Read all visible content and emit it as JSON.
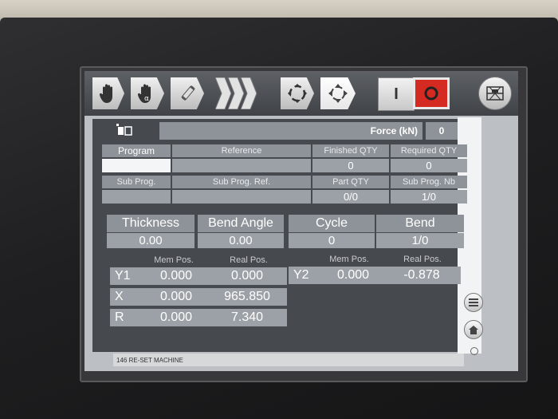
{
  "header": {
    "force_label": "Force (kN)",
    "force_value": "0"
  },
  "program": {
    "headers": [
      "Program",
      "Reference",
      "Finished QTY",
      "Required QTY"
    ],
    "values": [
      "",
      "",
      "0",
      "0"
    ],
    "sub_headers": [
      "Sub Prog.",
      "Sub Prog. Ref.",
      "Part QTY",
      "Sub Prog. Nb"
    ],
    "sub_values": [
      "",
      "",
      "0/0",
      "1/0"
    ]
  },
  "params": {
    "headers": [
      "Thickness",
      "Bend Angle",
      "Cycle",
      "Bend"
    ],
    "values": [
      "0.00",
      "0.00",
      "0",
      "1/0"
    ]
  },
  "axes": {
    "mem_label": "Mem Pos.",
    "real_label": "Real Pos.",
    "left": [
      {
        "name": "Y1",
        "mem": "0.000",
        "real": "0.000"
      },
      {
        "name": "X",
        "mem": "0.000",
        "real": "965.850"
      },
      {
        "name": "R",
        "mem": "0.000",
        "real": "7.340"
      }
    ],
    "right": [
      {
        "name": "Y2",
        "mem": "0.000",
        "real": "-0.878"
      }
    ]
  },
  "status": {
    "message": "146 RE-SET MACHINE"
  },
  "toolbar": {
    "icons": [
      "manual-hand-icon",
      "hand-alpha-icon",
      "pencil-edit-icon",
      "sequence-chevrons-icon",
      "rotate-inward-icon",
      "rotate-outward-icon",
      "power-on-icon",
      "power-off-icon",
      "machine-diagram-icon"
    ],
    "on_label": "I"
  },
  "colors": {
    "off_button": "#d42a22",
    "panel": "#46494e",
    "cell": "#9ca1a7"
  }
}
